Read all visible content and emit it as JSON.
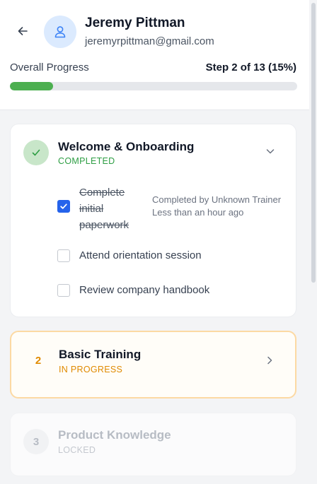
{
  "user": {
    "name": "Jeremy Pittman",
    "email": "jeremyrpittman@gmail.com",
    "avatar_icon": "user-icon"
  },
  "progress": {
    "label": "Overall Progress",
    "step_text": "Step 2 of 13 (15%)",
    "fraction": 0.15,
    "color": "#4caf50"
  },
  "stages": [
    {
      "title": "Welcome & Onboarding",
      "status": "COMPLETED",
      "status_color": "#2e9e44",
      "icon": "check-icon",
      "expanded": true,
      "tasks": [
        {
          "label": "Complete initial paperwork",
          "checked": true,
          "meta_line1": "Completed by Unknown Trainer",
          "meta_line2": "Less than an hour ago"
        },
        {
          "label": "Attend orientation session",
          "checked": false
        },
        {
          "label": "Review company handbook",
          "checked": false
        }
      ]
    },
    {
      "number": "2",
      "title": "Basic Training",
      "status": "IN PROGRESS",
      "status_color": "#e08a00",
      "icon": "chevron-right-icon"
    },
    {
      "number": "3",
      "title": "Product Knowledge",
      "status": "LOCKED",
      "status_color": "#c4c8cf"
    }
  ]
}
